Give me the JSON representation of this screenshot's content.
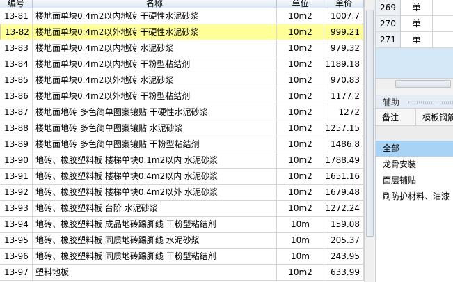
{
  "quota_table": {
    "columns": {
      "code": "编号",
      "name": "名称",
      "unit": "单位",
      "price": "单价"
    },
    "selected_index": 1,
    "rows": [
      {
        "code": "13-81",
        "name": "楼地面单块0.4m2以内地砖 干硬性水泥砂浆",
        "unit": "10m2",
        "price": "1007.7"
      },
      {
        "code": "13-82",
        "name": "楼地面单块0.4m2以外地砖 干硬性水泥砂浆",
        "unit": "10m2",
        "price": "999.21"
      },
      {
        "code": "13-83",
        "name": "楼地面单块0.4m2以内地砖 水泥砂浆",
        "unit": "10m2",
        "price": "979.32"
      },
      {
        "code": "13-84",
        "name": "楼地面单块0.4m2以内地砖 干粉型粘结剂",
        "unit": "10m2",
        "price": "1189.18"
      },
      {
        "code": "13-85",
        "name": "楼地面单块0.4m2以外地砖 水泥砂浆",
        "unit": "10m2",
        "price": "970.83"
      },
      {
        "code": "13-86",
        "name": "楼地面单块0.4m2以外地砖 干粉型粘结剂",
        "unit": "10m2",
        "price": "1177.2"
      },
      {
        "code": "13-87",
        "name": "楼地面地砖 多色简单图案镶贴 干硬性水泥砂浆",
        "unit": "10m2",
        "price": "1272"
      },
      {
        "code": "13-88",
        "name": "楼地面地砖 多色简单图案镶贴 水泥砂浆",
        "unit": "10m2",
        "price": "1257.15"
      },
      {
        "code": "13-89",
        "name": "楼地面地砖 多色简单图案镶贴 干粉型粘结剂",
        "unit": "10m2",
        "price": "1486.8"
      },
      {
        "code": "13-90",
        "name": "地砖、橡胶塑料板 楼梯单块0.1m2以内 水泥砂浆",
        "unit": "10m2",
        "price": "1788.49"
      },
      {
        "code": "13-91",
        "name": "地砖、橡胶塑料板 楼梯单块0.4m2以内 水泥砂浆",
        "unit": "10m2",
        "price": "1651.16"
      },
      {
        "code": "13-92",
        "name": "地砖、橡胶塑料板 楼梯单块0.4m2以外 水泥砂浆",
        "unit": "10m2",
        "price": "1679.48"
      },
      {
        "code": "13-93",
        "name": "地砖、橡胶塑料板 台阶 水泥砂浆",
        "unit": "10m2",
        "price": "1272.24"
      },
      {
        "code": "13-94",
        "name": "地砖、橡胶塑料板 成品地砖踢脚线 干粉型粘结剂",
        "unit": "10m",
        "price": "159.08"
      },
      {
        "code": "13-95",
        "name": "地砖、橡胶塑料板 同质地砖踢脚线 水泥砂浆",
        "unit": "10m",
        "price": "205.37"
      },
      {
        "code": "13-96",
        "name": "地砖、橡胶塑料板 同质地砖踢脚线 干粉型粘结剂",
        "unit": "10m",
        "price": "243.95"
      },
      {
        "code": "13-97",
        "name": "塑料地板",
        "unit": "10m2",
        "price": "633.99"
      }
    ]
  },
  "side_grid": {
    "rows": [
      {
        "num": "269",
        "value": "单"
      },
      {
        "num": "270",
        "value": "单"
      },
      {
        "num": "271",
        "value": "单"
      }
    ]
  },
  "aux_panel": {
    "title": "辅助",
    "tabs": [
      "备注",
      "模板钢筋"
    ],
    "items": [
      "全部",
      "龙骨安装",
      "面层铺贴",
      "刷防护材料、油漆"
    ],
    "active_index": 0
  },
  "colors": {
    "selected_row": "#ffff99",
    "active_item": "#a9d3f5",
    "header_bg": "#dde7f3"
  }
}
